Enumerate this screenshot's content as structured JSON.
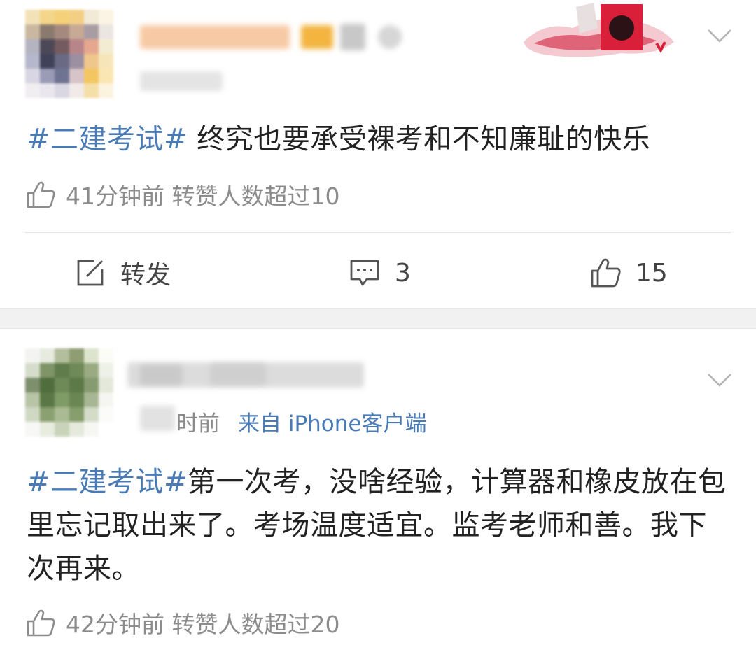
{
  "posts": [
    {
      "hashtag": "#二建考试#",
      "text": " 终究也要承受裸考和不知廉耻的快乐",
      "stats": "41分钟前 转赞人数超过10",
      "actions": {
        "repost_label": "转发",
        "comment_count": "3",
        "like_count": "15"
      },
      "avatar_colors": [
        "#f3e2b8",
        "#f4d58a",
        "#f5d27a",
        "#f3cf86",
        "#f2e9d6",
        "#fbf3e3",
        "#c9b79f",
        "#8a7a6e",
        "#a48a7e",
        "#c7a996",
        "#a89da2",
        "#ece6e3",
        "#b4b3c0",
        "#4d4858",
        "#755b60",
        "#b8868a",
        "#e5a88e",
        "#f4ecd2",
        "#b5b7cc",
        "#3f4259",
        "#6a6a84",
        "#9b8fa2",
        "#efc68c",
        "#f7e5ba",
        "#d8d6e2",
        "#9b9bb6",
        "#6f7392",
        "#d7c4c8",
        "#f3c661",
        "#fae6b2",
        "#f1eef1",
        "#e9e6ee",
        "#d9d7e2",
        "#f1eae8",
        "#f5dfa8",
        "#fcf3df"
      ]
    },
    {
      "meta_time": "时前",
      "meta_source": "来自 iPhone客户端",
      "hashtag": "#二建考试#",
      "text": "第一次考，没啥经验，计算器和橡皮放在包里忘记取出来了。考场温度适宜。监考老师和善。我下次再来。",
      "stats": "42分钟前 转赞人数超过20",
      "avatar_colors": [
        "#f3f4f1",
        "#e6eadf",
        "#b3be9c",
        "#8e9d72",
        "#dce4cd",
        "#fbfbf8",
        "#d5dccb",
        "#7f9567",
        "#5f7c4b",
        "#6f8a58",
        "#9aab82",
        "#eef1e7",
        "#7d8f6c",
        "#4f6d3d",
        "#6d8a57",
        "#5b7a47",
        "#879b71",
        "#e3e8da",
        "#b7c4a6",
        "#5a7745",
        "#7f9b66",
        "#6b8653",
        "#a7b693",
        "#f5f6f2",
        "#cfd8c3",
        "#8aa071",
        "#aabb93",
        "#869d6c",
        "#d4dcc8",
        "#fbfbfa",
        "#f7f8f5",
        "#e8ecdf",
        "#c9d3ba",
        "#e5eadc",
        "#f6f7f3",
        "#ffffff"
      ]
    }
  ],
  "colors": {
    "hashtag": "#4a7bb5",
    "muted": "#8c8c8c",
    "separator": "#f1f1f1"
  },
  "icons": {
    "like": "thumbs-up-icon",
    "repost": "edit-icon",
    "comment": "comment-icon",
    "more": "chevron-down-icon"
  }
}
